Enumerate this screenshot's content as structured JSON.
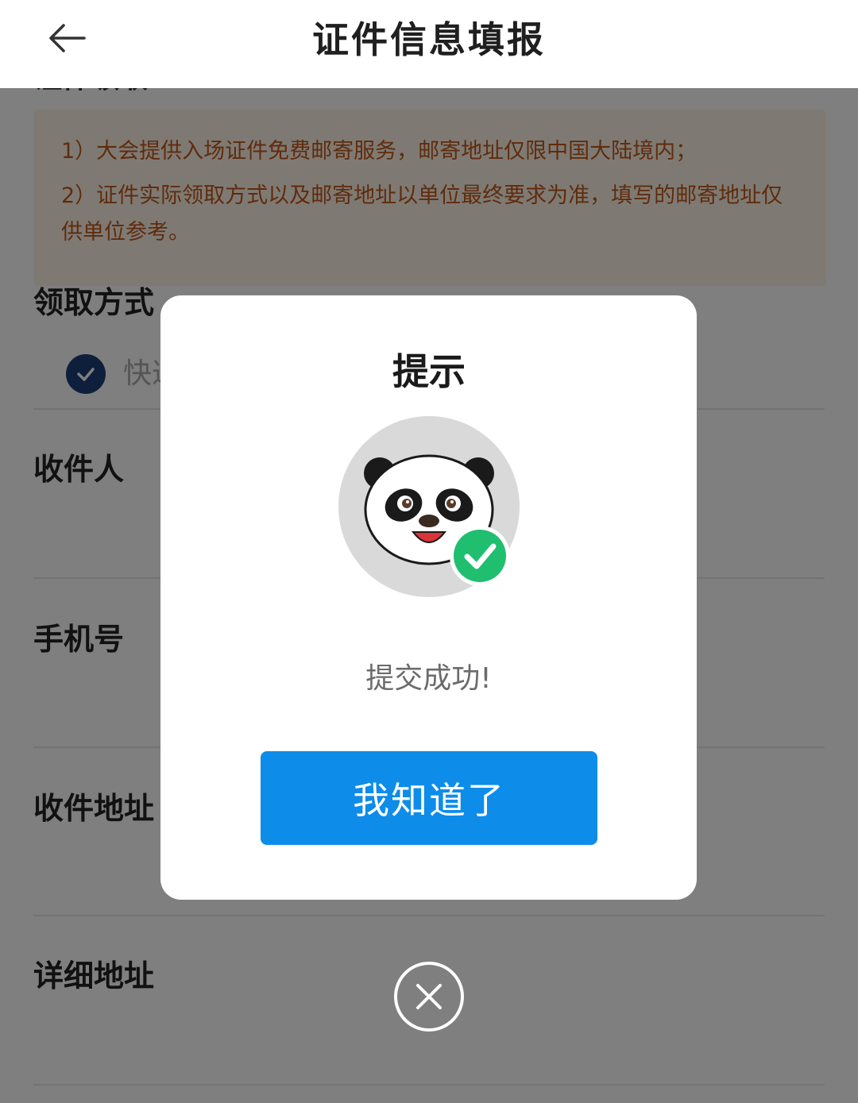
{
  "header": {
    "title": "证件信息填报",
    "back_icon": "arrow-left-icon"
  },
  "form": {
    "section_heading": "证件领取",
    "notice": {
      "line1": "1）大会提供入场证件免费邮寄服务，邮寄地址仅限中国大陆境内；",
      "line2": "2）证件实际领取方式以及邮寄地址以单位最终要求为准，填写的邮寄地址仅供单位参考。"
    },
    "pickup_method_label": "领取方式",
    "pickup_option": {
      "label": "快递",
      "checked": true
    },
    "recipient_label": "收件人",
    "phone_label": "手机号",
    "address_label": "收件地址",
    "detail_address_label": "详细地址"
  },
  "dialog": {
    "title": "提示",
    "avatar_icon": "panda-check-icon",
    "message": "提交成功!",
    "confirm_label": "我知道了",
    "close_icon": "close-circle-icon"
  },
  "colors": {
    "primary_button": "#0e8cea",
    "notice_text": "#c0571b",
    "notice_bg": "#fdf4e6",
    "radio_checked": "#1c3f78",
    "success_badge": "#1fbf6f"
  }
}
